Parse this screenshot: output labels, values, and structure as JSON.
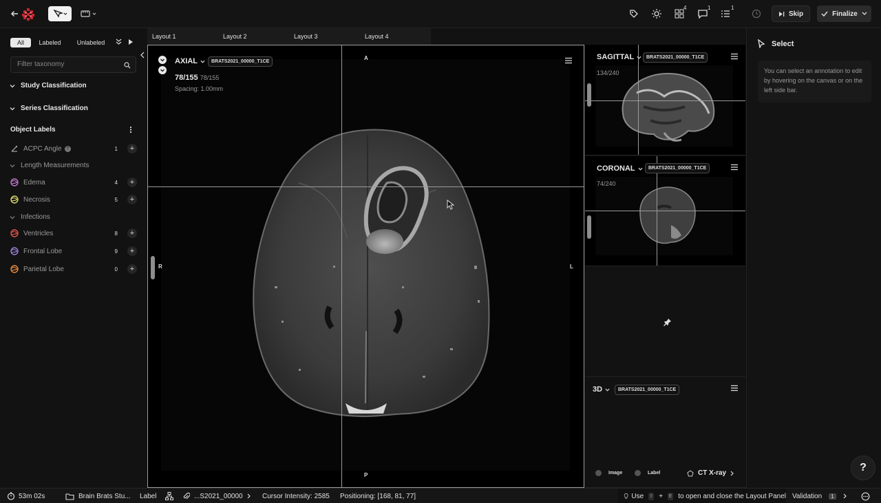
{
  "topbar": {
    "annotate_badge": "4",
    "comments_badge": "1",
    "list_badge": "1",
    "skip_label": "Skip",
    "finalize_label": "Finalize"
  },
  "left_panel": {
    "filters": [
      "All",
      "Labeled",
      "Unlabeled"
    ],
    "active_filter": "All",
    "filter_placeholder": "Filter taxonomy",
    "study_classification": "Study Classification",
    "series_classification": "Series Classification",
    "object_labels_title": "Object Labels",
    "labels": [
      {
        "name": "ACPC Angle",
        "count": "1",
        "color": "#a0a0a0",
        "icon": "angle-icon"
      },
      {
        "name": "Edema",
        "count": "4",
        "color": "#c07acb",
        "icon": "segmentation-icon"
      },
      {
        "name": "Necrosis",
        "count": "5",
        "color": "#d8d86a",
        "icon": "segmentation-icon"
      },
      {
        "name": "Ventricles",
        "count": "8",
        "color": "#e0584b",
        "icon": "segmentation-icon"
      },
      {
        "name": "Frontal Lobe",
        "count": "9",
        "color": "#9c80d8",
        "icon": "segmentation-icon"
      },
      {
        "name": "Parietal Lobe",
        "count": "0",
        "color": "#e58a3e",
        "icon": "segmentation-icon"
      }
    ],
    "groups": {
      "length": "Length Measurements",
      "infections": "Infections"
    }
  },
  "layout_tabs": [
    "Layout 1",
    "Layout 2",
    "Layout 3",
    "Layout 4"
  ],
  "axial": {
    "view": "AXIAL",
    "series": "BRATS2021_00000_T1CE",
    "slice": "78/155",
    "slice_total": "78/155",
    "spacing": "Spacing: 1.00mm",
    "orient": {
      "top": "A",
      "bottom": "P",
      "left": "R",
      "right": "L"
    }
  },
  "sagittal": {
    "view": "SAGITTAL",
    "series": "BRATS2021_00000_T1CE",
    "slice": "134/240"
  },
  "coronal": {
    "view": "CORONAL",
    "series": "BRATS2021_00000_T1CE",
    "slice": "74/240"
  },
  "view3d": {
    "view": "3D",
    "series": "BRATS2021_00000_T1CE",
    "image_toggle": "Image",
    "label_toggle": "Label",
    "preset": "CT X-ray"
  },
  "right_panel": {
    "title": "Select",
    "help": "You can select an annotation to edit by hovering on the canvas or on the left side bar."
  },
  "bottom": {
    "timer": "53m 02s",
    "project": "Brain Brats Stu...",
    "label_mode": "Label",
    "file": "...S2021_00000",
    "intensity": "Cursor Intensity: 2585",
    "positioning": "Positioning: [168, 81, 77]",
    "hint_use": "Use",
    "hint_plus": "+",
    "hint_text": "to open and close the Layout Panel",
    "validation": "Validation",
    "validation_count": "1"
  }
}
